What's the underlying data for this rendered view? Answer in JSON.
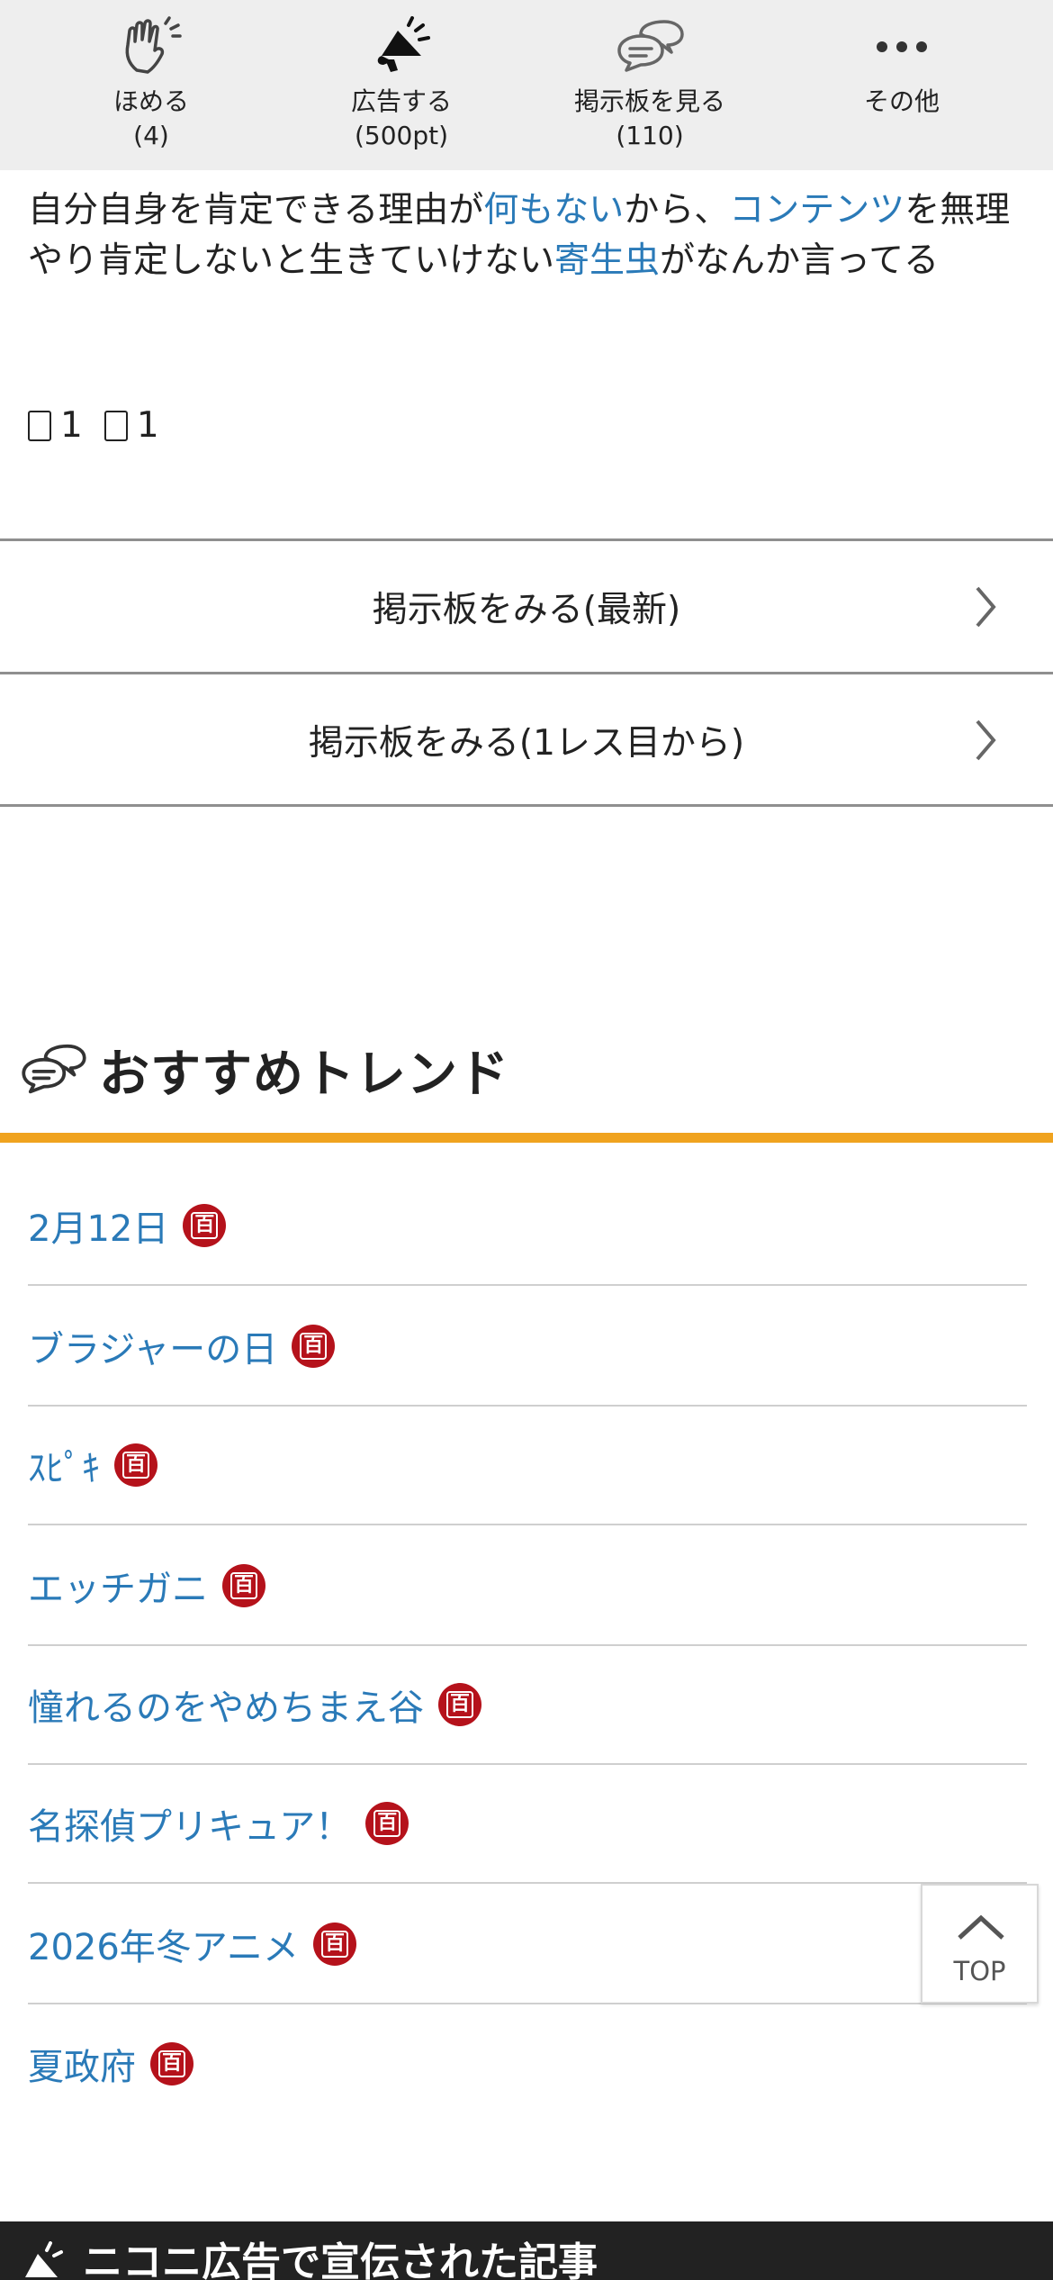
{
  "actions": [
    {
      "icon": "clap-icon",
      "label": "ほめる",
      "count": "(4)"
    },
    {
      "icon": "megaphone-icon",
      "label": "広告する",
      "count": "(500pt)"
    },
    {
      "icon": "speech-bubbles-icon",
      "label": "掲示板を見る",
      "count": "(110)"
    },
    {
      "icon": "more-dots-icon",
      "label": "その他",
      "count": ""
    }
  ],
  "comment": {
    "p1": "自分自身を肯定できる理由が",
    "l1": "何もない",
    "p2": "から、",
    "l2": "コンテンツ",
    "p3": "を無理やり肯定しないと生きていけない",
    "l3": "寄生虫",
    "p4": "がなんか言ってる"
  },
  "reactions": {
    "up_count": "1",
    "down_count": "1"
  },
  "board_buttons": {
    "latest": "掲示板をみる(最新)",
    "from_first": "掲示板をみる(1レス目から)"
  },
  "trend": {
    "title": "おすすめトレンド",
    "badge_glyph": "百",
    "items": [
      "2月12日",
      "ブラジャーの日",
      "ｽﾋﾟｷ",
      "エッチガニ",
      "憧れるのをやめちまえ谷",
      "名探偵プリキュア！",
      "2026年冬アニメ",
      "夏政府"
    ]
  },
  "top_button": "TOP",
  "bottom_bar": {
    "title": "ニコニ広告で宣伝された記事"
  },
  "colors": {
    "link": "#2a7ab8",
    "accent_rule": "#f0a31f",
    "badge": "#b5121b",
    "dark_bar": "#222222"
  }
}
